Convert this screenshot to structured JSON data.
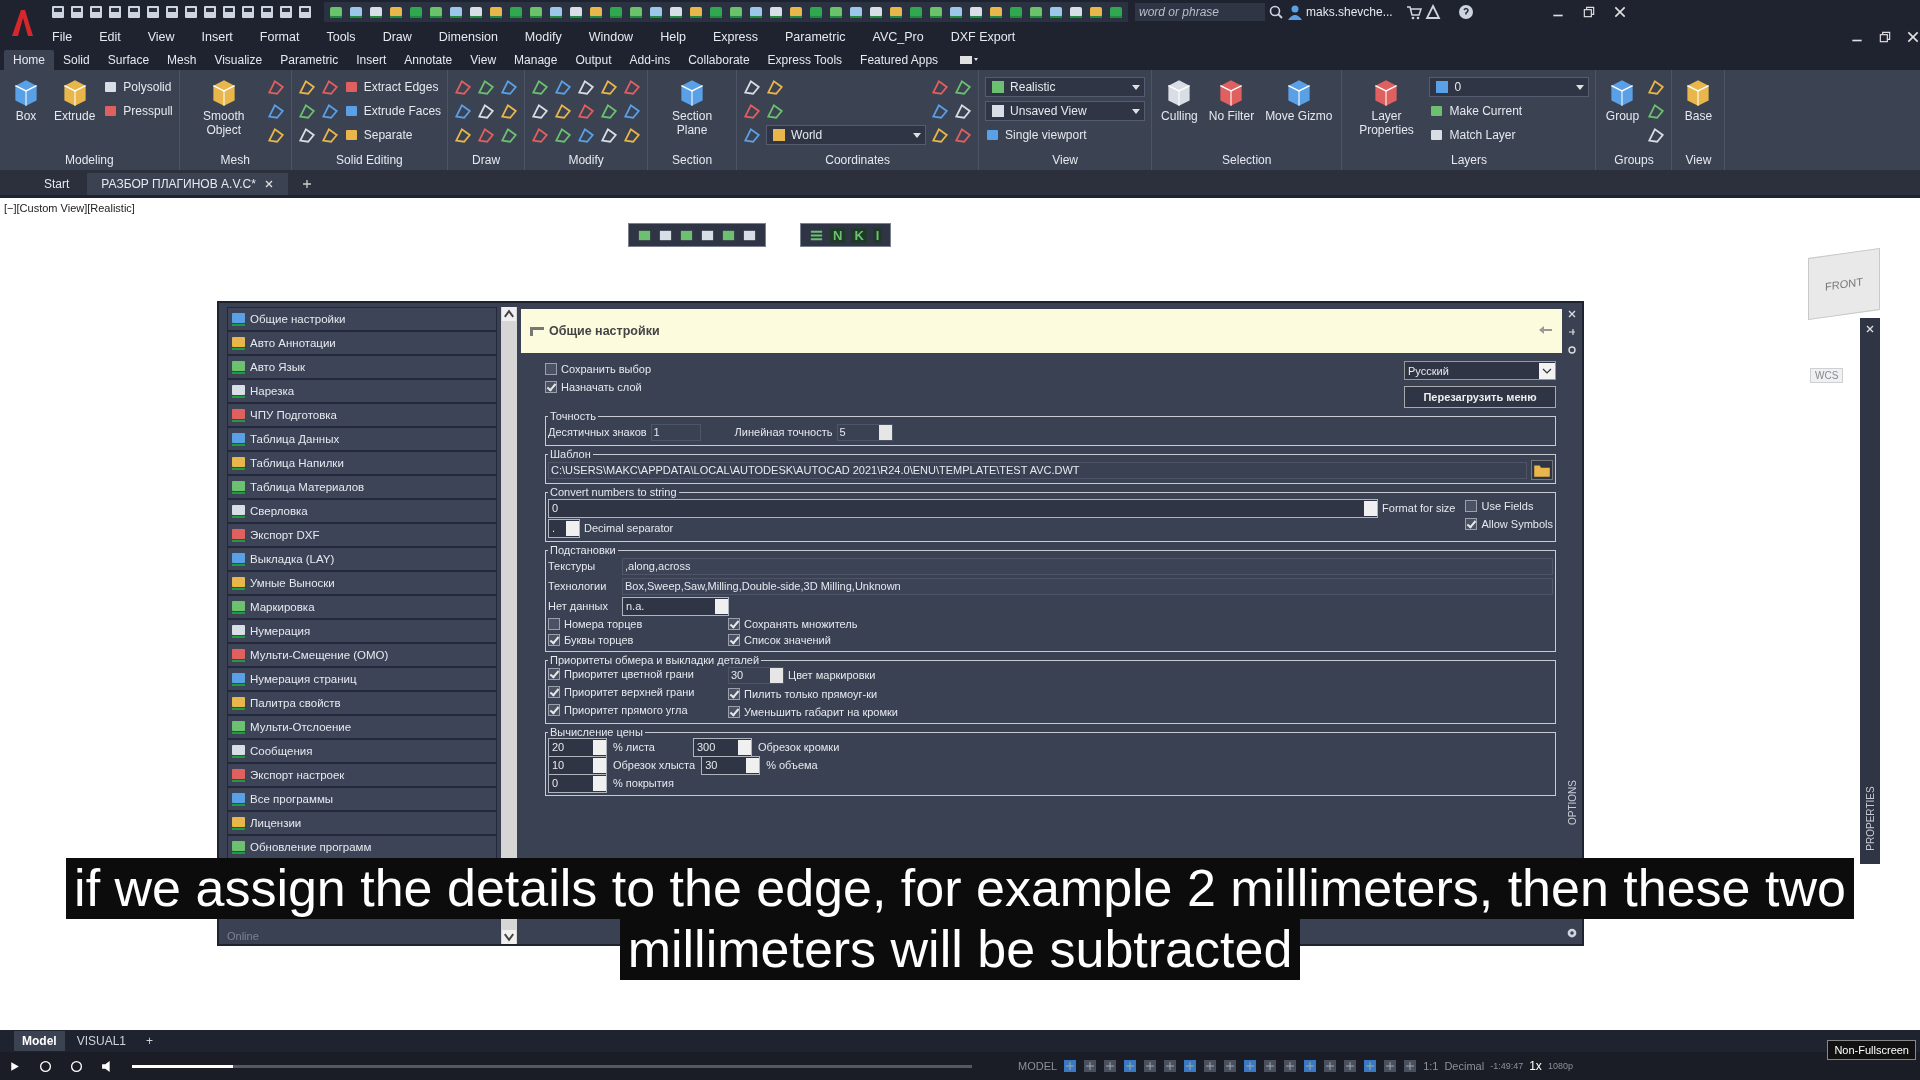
{
  "title_bar": {
    "search_placeholder": "word or phrase",
    "user": "maks.shevche..."
  },
  "menu_bar": [
    "File",
    "Edit",
    "View",
    "Insert",
    "Format",
    "Tools",
    "Draw",
    "Dimension",
    "Modify",
    "Window",
    "Help",
    "Express",
    "Parametric",
    "AVC_Pro",
    "DXF Export"
  ],
  "ribbon_tabs": [
    {
      "label": "Home",
      "selected": true
    },
    {
      "label": "Solid",
      "selected": false
    },
    {
      "label": "Surface",
      "selected": false
    },
    {
      "label": "Mesh",
      "selected": false
    },
    {
      "label": "Visualize",
      "selected": false
    },
    {
      "label": "Parametric",
      "selected": false
    },
    {
      "label": "Insert",
      "selected": false
    },
    {
      "label": "Annotate",
      "selected": false
    },
    {
      "label": "View",
      "selected": false
    },
    {
      "label": "Manage",
      "selected": false
    },
    {
      "label": "Output",
      "selected": false
    },
    {
      "label": "Add-ins",
      "selected": false
    },
    {
      "label": "Collaborate",
      "selected": false
    },
    {
      "label": "Express Tools",
      "selected": false
    },
    {
      "label": "Featured Apps",
      "selected": false
    }
  ],
  "ribbon_panels": [
    {
      "title": "Modeling",
      "items": [
        {
          "kind": "large",
          "label": "Box"
        },
        {
          "kind": "large",
          "label": "Extrude"
        },
        {
          "kind": "small",
          "label": "Polysolid"
        },
        {
          "kind": "small",
          "label": "Presspull"
        }
      ]
    },
    {
      "title": "Mesh",
      "items": [
        {
          "kind": "large",
          "label": "Smooth Object"
        },
        {
          "kind": "icon"
        },
        {
          "kind": "icon"
        },
        {
          "kind": "icon"
        }
      ]
    },
    {
      "title": "Solid Editing",
      "items": [
        {
          "kind": "icon"
        },
        {
          "kind": "icon"
        },
        {
          "kind": "icon"
        },
        {
          "kind": "icon"
        },
        {
          "kind": "icon"
        },
        {
          "kind": "icon"
        },
        {
          "kind": "small",
          "label": "Extract Edges"
        },
        {
          "kind": "small",
          "label": "Extrude Faces"
        },
        {
          "kind": "small",
          "label": "Separate"
        }
      ]
    },
    {
      "title": "Draw",
      "items": [
        {
          "kind": "icon"
        },
        {
          "kind": "icon"
        },
        {
          "kind": "icon"
        },
        {
          "kind": "icon"
        },
        {
          "kind": "icon"
        },
        {
          "kind": "icon"
        },
        {
          "kind": "icon"
        },
        {
          "kind": "icon"
        },
        {
          "kind": "icon"
        }
      ]
    },
    {
      "title": "Modify",
      "items": [
        {
          "kind": "icon"
        },
        {
          "kind": "icon"
        },
        {
          "kind": "icon"
        },
        {
          "kind": "icon"
        },
        {
          "kind": "icon"
        },
        {
          "kind": "icon"
        },
        {
          "kind": "icon"
        },
        {
          "kind": "icon"
        },
        {
          "kind": "icon"
        },
        {
          "kind": "icon"
        },
        {
          "kind": "icon"
        },
        {
          "kind": "icon"
        },
        {
          "kind": "icon"
        },
        {
          "kind": "icon"
        },
        {
          "kind": "icon"
        }
      ]
    },
    {
      "title": "Section",
      "items": [
        {
          "kind": "large",
          "label": "Section Plane"
        }
      ]
    },
    {
      "title": "Coordinates",
      "items": [
        {
          "kind": "icon"
        },
        {
          "kind": "icon"
        },
        {
          "kind": "icon"
        },
        {
          "kind": "icon"
        },
        {
          "kind": "icon"
        },
        {
          "kind": "dropdown",
          "label": "World"
        },
        {
          "kind": "icon"
        },
        {
          "kind": "icon"
        },
        {
          "kind": "icon"
        },
        {
          "kind": "icon"
        },
        {
          "kind": "icon"
        },
        {
          "kind": "icon"
        }
      ]
    },
    {
      "title": "View",
      "items": [
        {
          "kind": "dropdown",
          "label": "Realistic"
        },
        {
          "kind": "dropdown",
          "label": "Unsaved View"
        },
        {
          "kind": "small",
          "label": "Single viewport"
        }
      ]
    },
    {
      "title": "Selection",
      "items": [
        {
          "kind": "large",
          "label": "Culling"
        },
        {
          "kind": "large",
          "label": "No Filter"
        },
        {
          "kind": "large",
          "label": "Move Gizmo"
        }
      ]
    },
    {
      "title": "Layers",
      "items": [
        {
          "kind": "large",
          "label": "Layer Properties"
        },
        {
          "kind": "dropdown",
          "label": "0"
        },
        {
          "kind": "small",
          "label": "Make Current"
        },
        {
          "kind": "small",
          "label": "Match Layer"
        }
      ]
    },
    {
      "title": "Groups",
      "items": [
        {
          "kind": "large",
          "label": "Group"
        },
        {
          "kind": "icon"
        },
        {
          "kind": "icon"
        },
        {
          "kind": "icon"
        }
      ]
    },
    {
      "title": "View",
      "items": [
        {
          "kind": "large",
          "label": "Base"
        }
      ]
    }
  ],
  "doc_tabs": [
    {
      "label": "Start",
      "selected": false
    },
    {
      "label": "РАЗБОР ПЛАГИНОВ A.V.C*",
      "selected": true
    }
  ],
  "viewport": {
    "label": "[−][Custom View][Realistic]",
    "toolbar_letters": [
      "N",
      "K",
      "I"
    ],
    "viewcube": "FRONT",
    "wcs": "WCS",
    "palette_tab": "PROPERTIES"
  },
  "dialog": {
    "sidebar": [
      {
        "label": "Общие настройки"
      },
      {
        "label": "Авто Аннотации"
      },
      {
        "label": "Авто Язык"
      },
      {
        "label": "Нарезка"
      },
      {
        "label": "ЧПУ Подготовка"
      },
      {
        "label": "Таблица Данных"
      },
      {
        "label": "Таблица Напилки"
      },
      {
        "label": "Таблица Материалов"
      },
      {
        "label": "Сверловка"
      },
      {
        "label": "Экспорт DXF"
      },
      {
        "label": "Выкладка (LAY)"
      },
      {
        "label": "Умные Выноски"
      },
      {
        "label": "Маркировка"
      },
      {
        "label": "Нумерация"
      },
      {
        "label": "Мульти-Смещение (ОМО)"
      },
      {
        "label": "Нумерация страниц"
      },
      {
        "label": "Палитра свойств"
      },
      {
        "label": "Мульти-Отслоение"
      },
      {
        "label": "Сообщения"
      },
      {
        "label": "Экспорт настроек"
      },
      {
        "label": "Все программы"
      },
      {
        "label": "Лицензии"
      },
      {
        "label": "Обновление программ"
      }
    ],
    "sidebar_footer": "Online",
    "header": "Общие настройки",
    "options": [
      {
        "label": "Сохранить выбор",
        "checked": false
      },
      {
        "label": "Назначать слой",
        "checked": true
      }
    ],
    "language": "Русский",
    "reload_button": "Перезагрузить меню",
    "precision": {
      "title": "Точность",
      "decimals_label": "Десятичных знаков",
      "decimals": "1",
      "linear_label": "Линейная точность",
      "linear": "5"
    },
    "template": {
      "title": "Шаблон",
      "path": "C:\\USERS\\MAKC\\APPDATA\\LOCAL\\AUTODESK\\AUTOCAD 2021\\R24.0\\ENU\\TEMPLATE\\TEST AVC.DWT"
    },
    "convert": {
      "title": "Convert numbers to string",
      "format": "0",
      "format_label": "Format for size",
      "separator": ".",
      "separator_label": "Decimal separator",
      "checks": [
        {
          "label": "Use Fields",
          "checked": false
        },
        {
          "label": "Allow Symbols",
          "checked": true
        }
      ]
    },
    "substitutions": {
      "title": "Подстановки",
      "fields": [
        {
          "label": "Текстуры",
          "value": ",along,across"
        },
        {
          "label": "Технологии",
          "value": "Box,Sweep,Saw,Milling,Double-side,3D Milling,Unknown"
        }
      ],
      "no_data_label": "Нет данных",
      "no_data": "n.a.",
      "checks": [
        {
          "label": "Номера торцев",
          "checked": false
        },
        {
          "label": "Сохранять множитель",
          "checked": true
        },
        {
          "label": "Буквы торцев",
          "checked": true
        },
        {
          "label": "Список значений",
          "checked": true
        }
      ]
    },
    "priorities": {
      "title": "Приоритеты обмера и выкладки деталей",
      "left_checks": [
        {
          "label": "Приоритет цветной грани",
          "checked": true
        },
        {
          "label": "Приоритет верхней грани",
          "checked": true
        },
        {
          "label": "Приоритет прямого угла",
          "checked": true
        }
      ],
      "color_value": "30",
      "color_label": "Цвет маркировки",
      "right_checks": [
        {
          "label": "Пилить только прямоуг-ки",
          "checked": true
        },
        {
          "label": "Уменьшить габарит на кромки",
          "checked": true
        }
      ]
    },
    "price": {
      "title": "Вычисление цены",
      "rows": [
        [
          {
            "kind": "combo",
            "text": "20"
          },
          {
            "kind": "label",
            "text": "% листа"
          },
          {
            "kind": "combo",
            "text": "300"
          },
          {
            "kind": "label",
            "text": "Обрезок кромки"
          }
        ],
        [
          {
            "kind": "combo",
            "text": "10"
          },
          {
            "kind": "label",
            "text": "Обрезок хлыста"
          },
          {
            "kind": "combo",
            "text": "30"
          },
          {
            "kind": "label",
            "text": "% объема"
          }
        ],
        [
          {
            "kind": "combo",
            "text": "0"
          },
          {
            "kind": "label",
            "text": "% покрытия"
          }
        ]
      ]
    },
    "side_tab": "OPTIONS"
  },
  "subtitles": [
    "if we assign the details to the edge, for example 2 millimeters, then these two",
    "millimeters will be subtracted"
  ],
  "layout_tabs": [
    {
      "label": "Model",
      "selected": true
    },
    {
      "label": "VISUAL1",
      "selected": false
    },
    {
      "label": "+",
      "selected": false
    }
  ],
  "player": {
    "level": 0.12,
    "status_model": "MODEL",
    "scale": "1:1",
    "units": "Decimal",
    "time": "-1:49:47",
    "speed": "1x",
    "quality": "1080p",
    "tooltip": "Non-Fullscreen"
  }
}
